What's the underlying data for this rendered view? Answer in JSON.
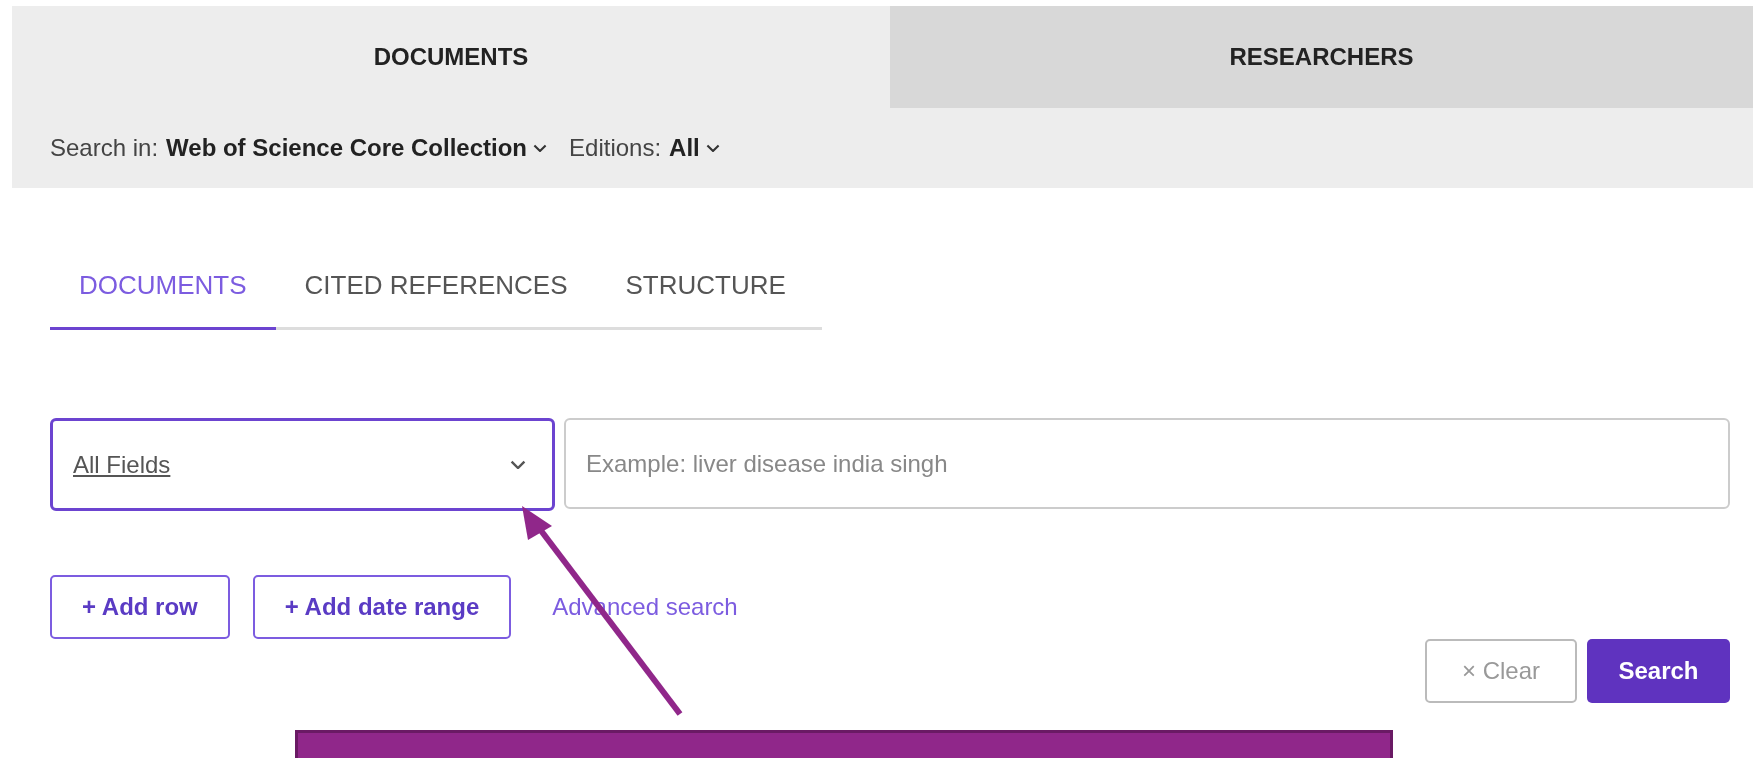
{
  "top_tabs": [
    {
      "label": "DOCUMENTS",
      "selected": true
    },
    {
      "label": "RESEARCHERS",
      "selected": false
    }
  ],
  "search_in": {
    "label": "Search in:",
    "value": "Web of Science Core Collection"
  },
  "editions": {
    "label": "Editions:",
    "value": "All"
  },
  "sub_tabs": [
    {
      "label": "DOCUMENTS",
      "selected": true
    },
    {
      "label": "CITED REFERENCES",
      "selected": false
    },
    {
      "label": "STRUCTURE",
      "selected": false
    }
  ],
  "field_select": {
    "value": "All Fields",
    "focused": true
  },
  "query": {
    "placeholder": "Example: liver disease india singh"
  },
  "add_buttons": [
    "+ Add row",
    "+ Add date range"
  ],
  "advanced_link": "Advanced search",
  "clear_button": {
    "icon": "×",
    "label": "Clear"
  },
  "search_button": "Search",
  "annotation": {
    "kind": "callout"
  }
}
